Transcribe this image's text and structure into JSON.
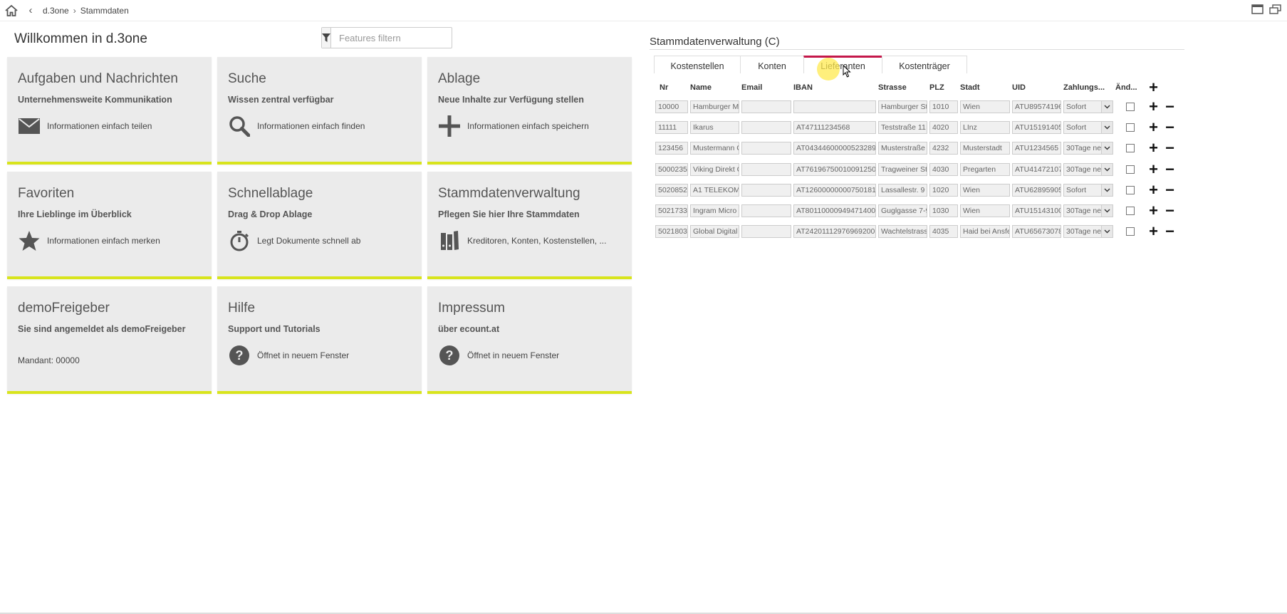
{
  "breadcrumb": {
    "items": [
      "d.3one",
      "Stammdaten"
    ]
  },
  "welcome_title": "Willkommen in d.3one",
  "filter": {
    "placeholder": "Features filtern"
  },
  "accent_color": "#d8e41c",
  "tab_active_color": "#c4184a",
  "tiles": [
    {
      "title": "Aufgaben und Nachrichten",
      "subtitle": "Unternehmensweite Kommunikation",
      "icon": "mail-icon",
      "action": "Informationen einfach teilen"
    },
    {
      "title": "Suche",
      "subtitle": "Wissen zentral verfügbar",
      "icon": "search-icon",
      "action": "Informationen einfach finden"
    },
    {
      "title": "Ablage",
      "subtitle": "Neue Inhalte zur Verfügung stellen",
      "icon": "plus-icon",
      "action": "Informationen einfach speichern"
    },
    {
      "title": "Favoriten",
      "subtitle": "Ihre Lieblinge im Überblick",
      "icon": "star-icon",
      "action": "Informationen einfach merken"
    },
    {
      "title": "Schnellablage",
      "subtitle": "Drag & Drop Ablage",
      "icon": "stopwatch-icon",
      "action": "Legt Dokumente schnell ab"
    },
    {
      "title": "Stammdatenverwaltung",
      "subtitle": "Pflegen Sie hier Ihre Stammdaten",
      "icon": "binders-icon",
      "action": "Kreditoren, Konten, Kostenstellen, ..."
    },
    {
      "title": "demoFreigeber",
      "subtitle": "Sie sind angemeldet als demoFreigeber",
      "icon": "",
      "action": "Mandant: 00000"
    },
    {
      "title": "Hilfe",
      "subtitle": "Support und Tutorials",
      "icon": "help-icon",
      "action": "Öffnet in neuem Fenster"
    },
    {
      "title": "Impressum",
      "subtitle": "über ecount.at",
      "icon": "help-icon",
      "action": "Öffnet in neuem Fenster"
    }
  ],
  "stammdaten": {
    "title": "Stammdatenverwaltung (C)",
    "tabs": [
      "Kostenstellen",
      "Konten",
      "Lieferanten",
      "Kostenträger"
    ],
    "active_tab": "Lieferanten",
    "columns": [
      "Nr",
      "Name",
      "Email",
      "IBAN",
      "Strasse",
      "PLZ",
      "Stadt",
      "UID",
      "Zahlungs...",
      "Änd..."
    ],
    "rows": [
      {
        "nr": "10000",
        "name": "Hamburger M:",
        "email": "",
        "iban": "",
        "strasse": "Hamburger St:",
        "plz": "1010",
        "stadt": "Wien",
        "uid": "ATU89574196",
        "zahlung": "Sofort"
      },
      {
        "nr": "11111",
        "name": "Ikarus",
        "email": "",
        "iban": "AT47111234568",
        "strasse": "Teststraße 11",
        "plz": "4020",
        "stadt": "LInz",
        "uid": "ATU15191405",
        "zahlung": "Sofort"
      },
      {
        "nr": "123456",
        "name": "Mustermann G",
        "email": "",
        "iban": "AT04344600000523289",
        "strasse": "Musterstraße 1",
        "plz": "4232",
        "stadt": "Musterstadt",
        "uid": "ATU1234565",
        "zahlung": "30Tage ne"
      },
      {
        "nr": "5000235",
        "name": "Viking Direkt C",
        "email": "",
        "iban": "AT76196750010091250",
        "strasse": "Tragweiner St:",
        "plz": "4030",
        "stadt": "Pregarten",
        "uid": "ATU41472107",
        "zahlung": "30Tage ne"
      },
      {
        "nr": "5020852",
        "name": "A1 TELEKOM A",
        "email": "",
        "iban": "AT12600000000750181",
        "strasse": "Lassallestr. 9",
        "plz": "1020",
        "stadt": "Wien",
        "uid": "ATU62895905",
        "zahlung": "Sofort"
      },
      {
        "nr": "5021733",
        "name": "Ingram Micro (",
        "email": "",
        "iban": "AT80110000949471400",
        "strasse": "Guglgasse 7-9",
        "plz": "1030",
        "stadt": "Wien",
        "uid": "ATU15143100",
        "zahlung": "30Tage ne"
      },
      {
        "nr": "5021803",
        "name": "Global Digital I",
        "email": "",
        "iban": "AT24201112976969200",
        "strasse": "Wachtelstrasse",
        "plz": "4035",
        "stadt": "Haid bei Ansfe",
        "uid": "ATU65673078",
        "zahlung": "30Tage ne"
      }
    ]
  }
}
